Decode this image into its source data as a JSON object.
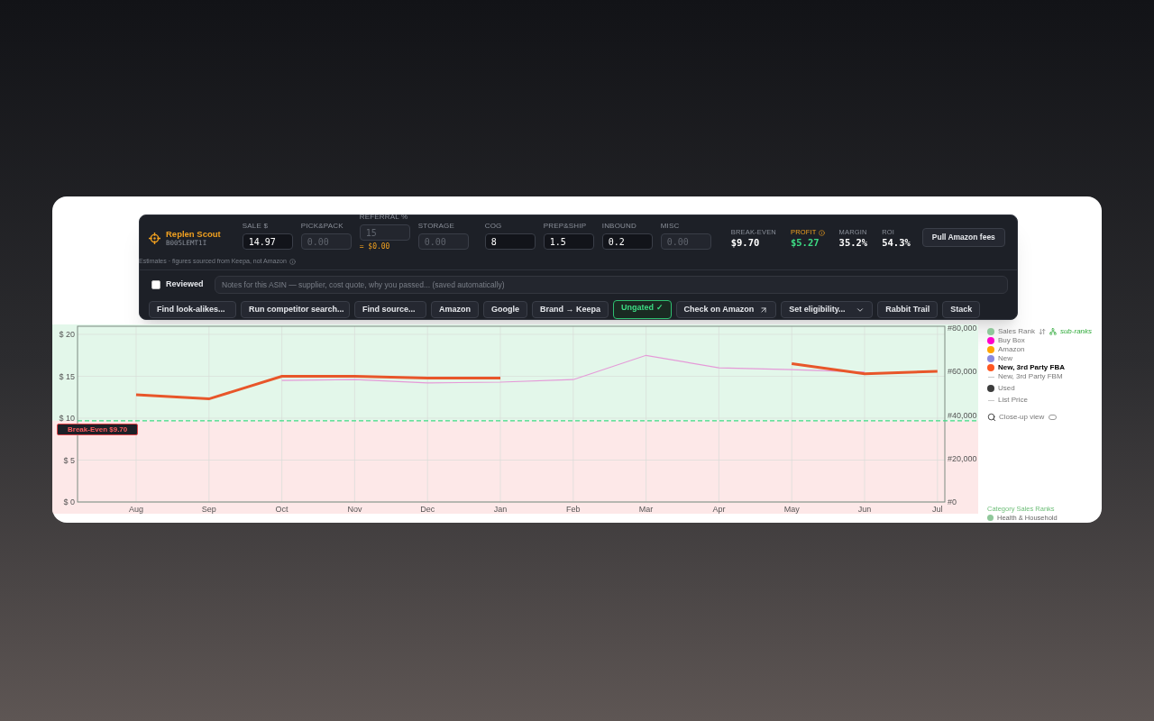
{
  "toolbar": {
    "app_name": "Replen Scout",
    "asin": "B005LEMT1I",
    "price_fields": [
      {
        "label": "SALE $",
        "value": "14.97"
      },
      {
        "label": "PICK&PACK",
        "placeholder": "0.00"
      },
      {
        "label": "REFERRAL %",
        "placeholder": "15",
        "note": "= $0.00"
      },
      {
        "label": "STORAGE",
        "placeholder": "0.00"
      }
    ],
    "cost_fields": [
      {
        "label": "COG",
        "value": "8"
      },
      {
        "label": "PREP&SHIP",
        "value": "1.5"
      },
      {
        "label": "INBOUND",
        "value": "0.2"
      },
      {
        "label": "MISC",
        "placeholder": "0.00"
      }
    ],
    "stats": [
      {
        "label": "BREAK-EVEN",
        "value": "$9.70",
        "kind": "plain"
      },
      {
        "label": "PROFIT",
        "value": "$5.27",
        "kind": "highlight"
      },
      {
        "label": "MARGIN",
        "value": "35.2%",
        "kind": "plain"
      },
      {
        "label": "ROI",
        "value": "54.3%",
        "kind": "plain"
      }
    ],
    "fees_button": "Pull Amazon fees",
    "disclaimer": "Estimates · figures sourced from Keepa, not Amazon",
    "reviewed": {
      "label": "Reviewed",
      "checked": false
    },
    "notes": {
      "placeholder": "Notes for this ASIN — supplier, cost quote, why you passed... (saved automatically)"
    },
    "actions": [
      {
        "label": "Find look-alikes...",
        "kind": "dropdown"
      },
      {
        "label": "Run competitor search...",
        "kind": "dropdown"
      },
      {
        "label": "Find source...",
        "kind": "dropdown"
      },
      {
        "label": "Amazon",
        "kind": "button"
      },
      {
        "label": "Google",
        "kind": "button"
      },
      {
        "label": "Brand → Keepa",
        "kind": "button"
      },
      {
        "label": "Ungated ✓",
        "kind": "status"
      },
      {
        "label": "Check on Amazon",
        "kind": "external"
      },
      {
        "label": "Set eligibility...",
        "kind": "dropdown"
      },
      {
        "label": "Rabbit Trail",
        "kind": "button"
      },
      {
        "label": "Stack",
        "kind": "button"
      }
    ]
  },
  "chart": {
    "chart_data": {
      "type": "line",
      "categories": [
        "Aug",
        "Sep",
        "Oct",
        "Nov",
        "Dec",
        "Jan",
        "Feb",
        "Mar",
        "Apr",
        "May",
        "Jun",
        "Jul"
      ],
      "series": [
        {
          "color": "#e59ad8",
          "values": [
            null,
            null,
            14.5,
            14.6,
            14.2,
            14.3,
            14.6,
            17.5,
            16,
            15.8,
            15.5,
            null
          ]
        },
        {
          "color": "#e8562a",
          "values": [
            12.8,
            12.3,
            15,
            15,
            14.8,
            14.8,
            null,
            null,
            null,
            16.5,
            15.3,
            15.6
          ]
        }
      ],
      "grid": true,
      "ylim": [
        0,
        20
      ],
      "y2lim": [
        0,
        80000
      ],
      "yticks": [
        {
          "value": 0,
          "label": "$ 0"
        },
        {
          "value": 5,
          "label": "$ 5"
        },
        {
          "value": 10,
          "label": "$ 10"
        },
        {
          "value": 15,
          "label": "$ 15"
        },
        {
          "value": 20,
          "label": "$ 20"
        }
      ],
      "y2ticks": [
        {
          "value": 0,
          "label": "#0"
        },
        {
          "value": 20000,
          "label": "#20,000"
        },
        {
          "value": 40000,
          "label": "#40,000"
        },
        {
          "value": 60000,
          "label": "#60,000"
        },
        {
          "value": 80000,
          "label": "#80,000"
        }
      ],
      "ref_lines": [
        {
          "axis": "y",
          "value": 9.7,
          "label": "Break-Even $9.70",
          "color": "#3ddc84"
        }
      ]
    },
    "legend": [
      {
        "label": "Sales Rank",
        "kind": "dot",
        "color": "#8fc79a"
      },
      {
        "label": "Buy Box",
        "kind": "dot",
        "color": "#ff00cc"
      },
      {
        "label": "Amazon",
        "kind": "dot",
        "color": "#ffa500"
      },
      {
        "label": "New",
        "kind": "dot",
        "color": "#8a8ae0"
      },
      {
        "label": "New, 3rd Party FBA",
        "kind": "dot",
        "color": "#ff5722",
        "selected": true
      },
      {
        "label": "New, 3rd Party FBM",
        "kind": "line",
        "color": "#c8c8c8",
        "selected": false
      },
      {
        "label": "Used",
        "kind": "dot",
        "color": "#3d3d3d"
      },
      {
        "label": "List Price",
        "kind": "line",
        "color": "#c8c8c8"
      }
    ],
    "sub_ranks": "sub-ranks",
    "closeup": {
      "label": "Close-up view",
      "on": false
    },
    "category_title": "Category Sales Ranks",
    "category_item": "Health & Household"
  }
}
